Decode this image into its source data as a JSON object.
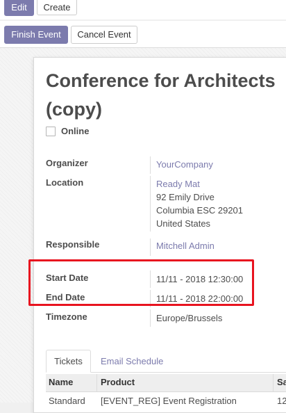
{
  "toolbar": {
    "edit_label": "Edit",
    "create_label": "Create"
  },
  "statusbar": {
    "finish_label": "Finish Event",
    "cancel_label": "Cancel Event"
  },
  "record": {
    "title_line1": "Conference for Architects",
    "title_line2": "(copy)",
    "online_label": "Online",
    "online_checked": false
  },
  "fields": {
    "organizer": {
      "label": "Organizer",
      "value": "YourCompany"
    },
    "location": {
      "label": "Location",
      "name": "Ready Mat",
      "street": "92 Emily Drive",
      "city_line": "Columbia ESC 29201",
      "country": "United States"
    },
    "responsible": {
      "label": "Responsible",
      "value": "Mitchell Admin"
    },
    "start_date": {
      "label": "Start Date",
      "value": "11/11 - 2018 12:30:00"
    },
    "end_date": {
      "label": "End Date",
      "value": "11/11 - 2018 22:00:00"
    },
    "timezone": {
      "label": "Timezone",
      "value": "Europe/Brussels"
    }
  },
  "tabs": [
    {
      "label": "Tickets",
      "active": true
    },
    {
      "label": "Email Schedule",
      "active": false
    }
  ],
  "table": {
    "headers": [
      "Name",
      "Product",
      "Sa"
    ],
    "rows": [
      {
        "name": "Standard",
        "product": "[EVENT_REG] Event Registration",
        "sale": "12"
      }
    ]
  },
  "colors": {
    "primary": "#7c7bad",
    "link": "#7c7bad",
    "highlight": "#e8131f"
  }
}
